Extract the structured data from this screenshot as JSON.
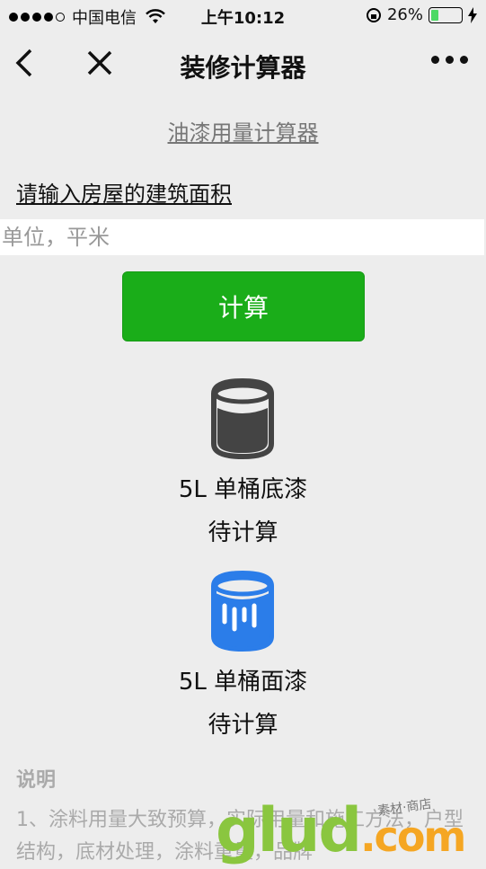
{
  "status_bar": {
    "carrier": "中国电信",
    "time": "上午10:12",
    "battery_percent": "26%",
    "battery_level": 0.26,
    "colors": {
      "battery": "#4cd964"
    }
  },
  "nav": {
    "title": "装修计算器",
    "back_icon": "chevron-left-icon",
    "close_icon": "close-icon",
    "more_icon": "more-dots-icon"
  },
  "page": {
    "subtitle": "油漆用量计算器",
    "prompt": "请输入房屋的建筑面积",
    "area_input": {
      "value": "",
      "placeholder": "单位，平米"
    },
    "calc_button": "计算",
    "primer": {
      "icon": "paint-bucket-icon",
      "name": "5L 单桶底漆",
      "result": "待计算"
    },
    "topcoat": {
      "icon": "paint-bucket-icon",
      "name": "5L 单桶面漆",
      "result": "待计算"
    },
    "notes_title": "说明",
    "notes_text": "1、涂料用量大致预算，实际用量和施工方法，户型结构，底材处理，涂料重量，品牌",
    "watermark": "glud.com",
    "watermark_small": "素材·商店",
    "colors": {
      "button": "#1aad19",
      "topcoat_icon": "#2b7de9",
      "primer_icon": "#444444"
    }
  }
}
